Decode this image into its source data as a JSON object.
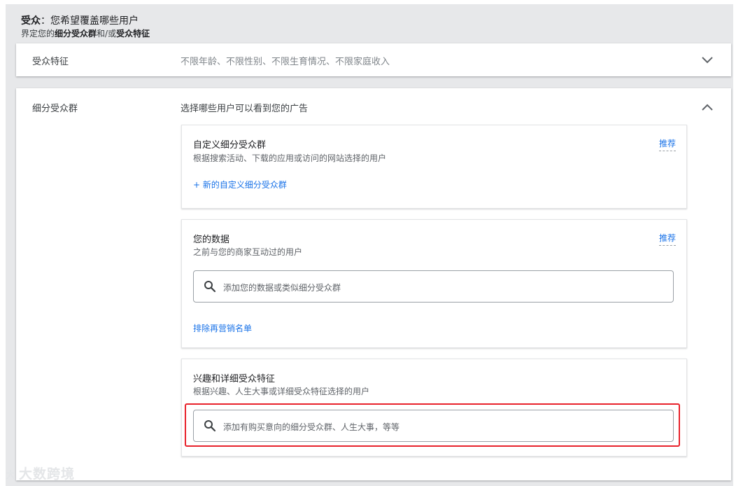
{
  "header": {
    "title_bold": "受众",
    "title_rest": "：您希望覆盖哪些用户",
    "subtitle_prefix": "界定您的",
    "subtitle_bold1": "细分受众群",
    "subtitle_mid": "和/或",
    "subtitle_bold2": "受众特征"
  },
  "demographics": {
    "label": "受众特征",
    "summary": "不限年龄、不限性别、不限生育情况、不限家庭收入",
    "icon": "chevron-down-icon"
  },
  "segments": {
    "label": "细分受众群",
    "prompt": "选择哪些用户可以看到您的广告",
    "icon": "chevron-up-icon",
    "custom": {
      "title": "自定义细分受众群",
      "desc": "根据搜索活动、下载的应用或访问的网站选择的用户",
      "recommend": "推荐",
      "new_link": "+ 新的自定义细分受众群"
    },
    "your_data": {
      "title": "您的数据",
      "desc": "之前与您的商家互动过的用户",
      "recommend": "推荐",
      "search_placeholder": "添加您的数据或类似细分受众群",
      "exclude_link": "排除再营销名单"
    },
    "interests": {
      "title": "兴趣和详细受众特征",
      "desc": "根据兴趣、人生大事或详细受众特征选择的用户",
      "search_placeholder": "添加有购买意向的细分受众群、人生大事，等等"
    }
  },
  "watermark": {
    "text": "大数跨境",
    "logo_text": "大"
  },
  "colors": {
    "accent": "#1a73e8",
    "highlight": "#e8222b",
    "frame": "#e7e8ea"
  }
}
